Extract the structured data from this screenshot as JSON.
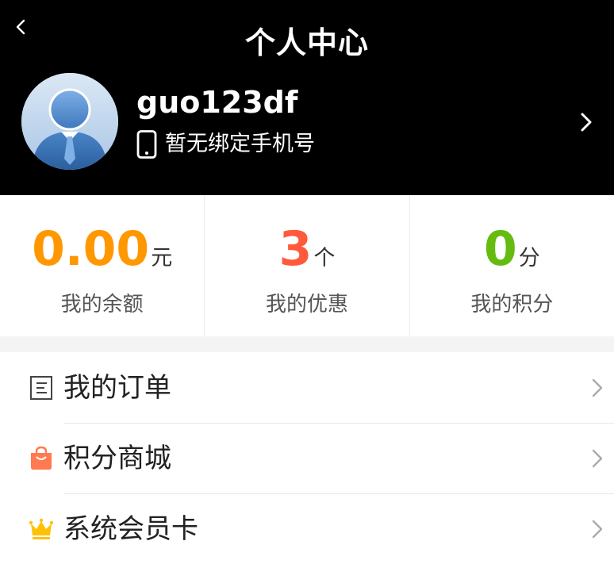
{
  "header": {
    "title": "个人中心"
  },
  "profile": {
    "username": "guo123df",
    "phone_text": "暂无绑定手机号"
  },
  "stats": [
    {
      "value": "0.00",
      "unit": "元",
      "label": "我的余额",
      "color": "#ff9800"
    },
    {
      "value": "3",
      "unit": "个",
      "label": "我的优惠",
      "color": "#ff5a3c"
    },
    {
      "value": "0",
      "unit": "分",
      "label": "我的积分",
      "color": "#66bb11"
    }
  ],
  "menu": [
    {
      "label": "我的订单",
      "icon": "order-list-icon"
    },
    {
      "label": "积分商城",
      "icon": "shopping-bag-icon"
    },
    {
      "label": "系统会员卡",
      "icon": "crown-icon"
    }
  ],
  "colors": {
    "header_bg": "#000000",
    "page_bg": "#f4f4f4",
    "bag_icon": "#ff7a50",
    "crown_icon": "#ffc107"
  }
}
